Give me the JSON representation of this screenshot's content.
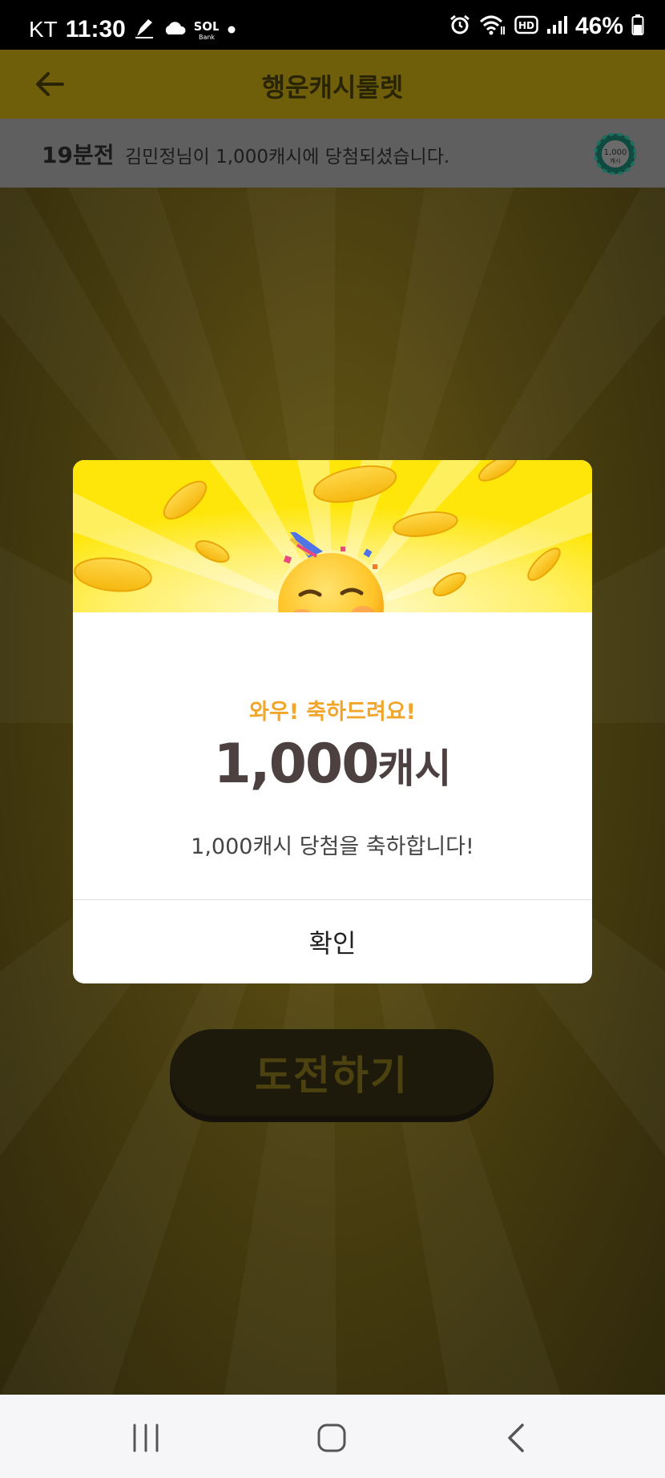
{
  "status_bar": {
    "carrier": "KT",
    "time": "11:30",
    "battery": "46%",
    "icons_left": [
      "pen-icon",
      "cloud-icon",
      "sol-bank-icon",
      "dot-icon"
    ],
    "icons_right": [
      "alarm-icon",
      "wifi-icon",
      "hd-icon",
      "signal-icon",
      "battery-icon"
    ]
  },
  "app_bar": {
    "title": "행운캐시룰렛",
    "back_icon": "back-arrow-icon"
  },
  "ticker": {
    "time_ago": "19분전",
    "message": "김민정님이 1,000캐시에 당첨되셨습니다.",
    "badge_text": "1,000",
    "badge_unit": "캐시"
  },
  "challenge_button": {
    "label": "도전하기"
  },
  "modal": {
    "subtitle": "와우! 축하드려요!",
    "amount": "1,000",
    "amount_unit": "캐시",
    "description": "1,000캐시 당첨을 축하합니다!",
    "confirm_label": "확인"
  },
  "colors": {
    "accent_yellow": "#fee60a",
    "subtitle_orange": "#f0a62a",
    "amount_text": "#4d4040"
  },
  "nav_bar": {
    "items": [
      "recent-apps-icon",
      "home-icon",
      "back-icon"
    ]
  }
}
